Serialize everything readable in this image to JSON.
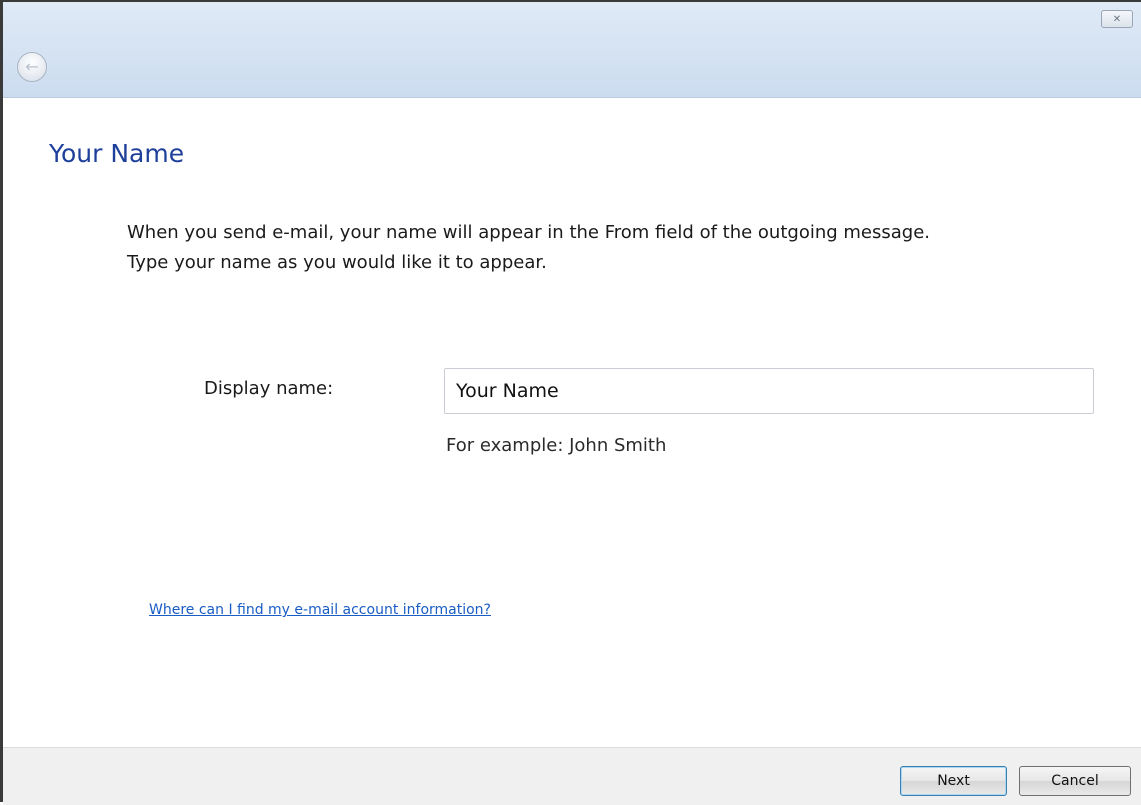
{
  "window": {
    "close_glyph": "✕",
    "back_glyph": "←"
  },
  "page": {
    "title": "Your Name",
    "description_line1": "When you send e-mail, your name will appear in the From field of the outgoing message.",
    "description_line2": "Type your name as you would like it to appear."
  },
  "form": {
    "display_name_label": "Display name:",
    "display_name_value": "Your Name",
    "example_text": "For example: John Smith"
  },
  "help_link": "Where can I find my e-mail account information?",
  "footer": {
    "next_label": "Next",
    "cancel_label": "Cancel"
  },
  "colors": {
    "title": "#1e3f9a",
    "link": "#1a5dc4",
    "titlebar": "#d5e3f2"
  }
}
